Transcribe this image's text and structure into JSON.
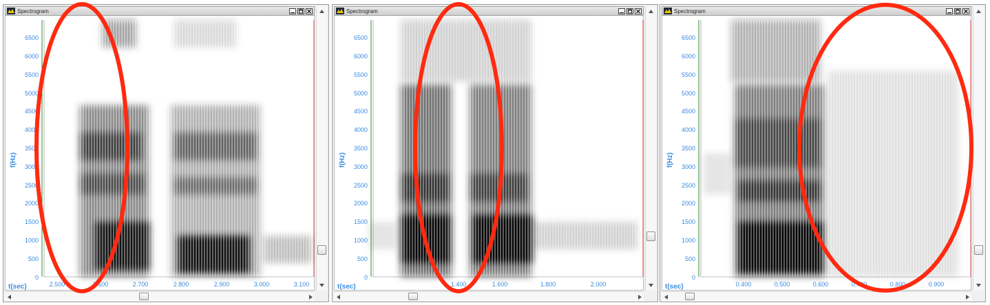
{
  "colors": {
    "axis_text": "#3a8be0",
    "cursor_green": "#2b8f2b",
    "cursor_red": "#e24b4b",
    "annotation": "#ff2a10",
    "spectrogram_ink": "#000000"
  },
  "panels": [
    {
      "window_title": "Spectrogram",
      "y_axis_label": "f(Hz)",
      "x_axis_label": "t(sec)",
      "y_ticks": [
        "6500",
        "6000",
        "5500",
        "5000",
        "4500",
        "4000",
        "3500",
        "3000",
        "2500",
        "2000",
        "1500",
        "1000",
        "500",
        "0"
      ],
      "x_ticks": [
        "2.500",
        "2.600",
        "2.700",
        "2.800",
        "2.900",
        "3.000",
        "3.100"
      ],
      "minimize_icon": "minimize-icon",
      "restore_icon": "restore-icon",
      "close_icon": "close-icon",
      "scroll": {
        "vertical_position": 0.84,
        "horizontal_position": 0.45
      }
    },
    {
      "window_title": "Spectrogram",
      "y_axis_label": "f(Hz)",
      "x_axis_label": "t(sec)",
      "y_ticks": [
        "6500",
        "6000",
        "5500",
        "5000",
        "4500",
        "4000",
        "3500",
        "3000",
        "2500",
        "2000",
        "1500",
        "1000",
        "500",
        "0"
      ],
      "x_ticks": [
        "1.400",
        "1.600",
        "1.800",
        "2.000"
      ],
      "minimize_icon": "minimize-icon",
      "restore_icon": "restore-icon",
      "close_icon": "close-icon",
      "scroll": {
        "vertical_position": 0.84,
        "horizontal_position": 0.26
      }
    },
    {
      "window_title": "Spectrogram",
      "y_axis_label": "f(Hz)",
      "x_axis_label": "t(sec)",
      "y_ticks": [
        "6500",
        "6000",
        "5500",
        "5000",
        "4500",
        "4000",
        "3500",
        "3000",
        "2500",
        "2000",
        "1500",
        "1000",
        "500",
        "0"
      ],
      "x_ticks": [
        "0.400",
        "0.500",
        "0.600",
        "0.700",
        "0.800",
        "0.900"
      ],
      "minimize_icon": "minimize-icon",
      "restore_icon": "restore-icon",
      "close_icon": "close-icon",
      "scroll": {
        "vertical_position": 0.84,
        "horizontal_position": 0.08
      }
    }
  ]
}
